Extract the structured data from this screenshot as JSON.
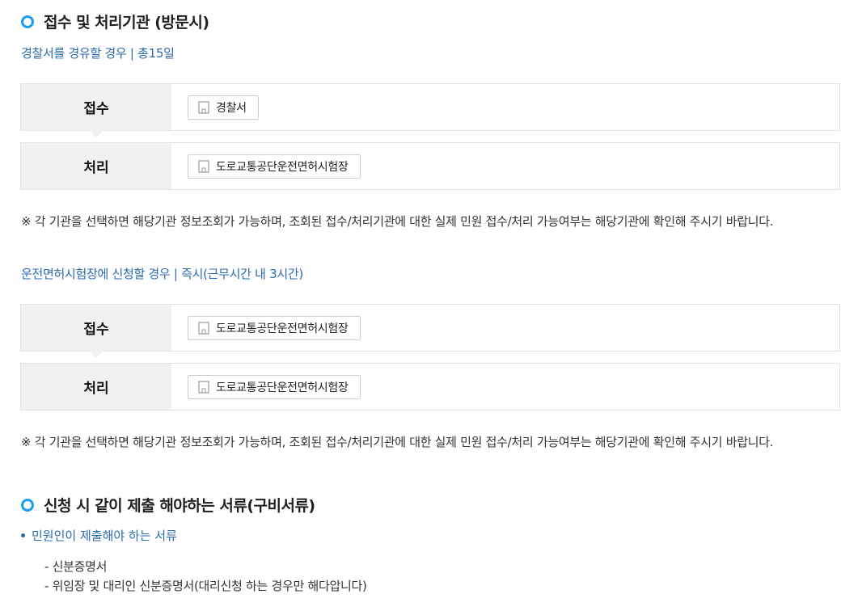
{
  "section1": {
    "title": "접수 및 처리기관 (방문시)",
    "route1": {
      "label": "경찰서를 경유할 경우 | 총15일",
      "rows": [
        {
          "head": "접수",
          "agency": "경찰서"
        },
        {
          "head": "처리",
          "agency": "도로교통공단운전면허시험장"
        }
      ],
      "note": "※ 각 기관을 선택하면 해당기관 정보조회가 가능하며, 조회된 접수/처리기관에 대한 실제 민원 접수/처리 가능여부는 해당기관에 확인해 주시기 바랍니다."
    },
    "route2": {
      "label": "운전면허시험장에 신청할 경우 | 즉시(근무시간 내 3시간)",
      "rows": [
        {
          "head": "접수",
          "agency": "도로교통공단운전면허시험장"
        },
        {
          "head": "처리",
          "agency": "도로교통공단운전면허시험장"
        }
      ],
      "note": "※ 각 기관을 선택하면 해당기관 정보조회가 가능하며, 조회된 접수/처리기관에 대한 실제 민원 접수/처리 가능여부는 해당기관에 확인해 주시기 바랍니다."
    }
  },
  "section2": {
    "title": "신청 시 같이 제출 해야하는 서류(구비서류)",
    "subhead": "민원인이 제출해야 하는 서류",
    "items": [
      "- 신분증명서",
      "- 위임장 및 대리인 신분증명서(대리신청 하는 경우만 해다압니다)"
    ]
  },
  "colors": {
    "accent": "#1a9cf0",
    "link": "#2a6bb0",
    "head_bg": "#f1f1f4"
  },
  "icons": {
    "agency": "building-icon",
    "bullet": "circle-ring-icon"
  }
}
